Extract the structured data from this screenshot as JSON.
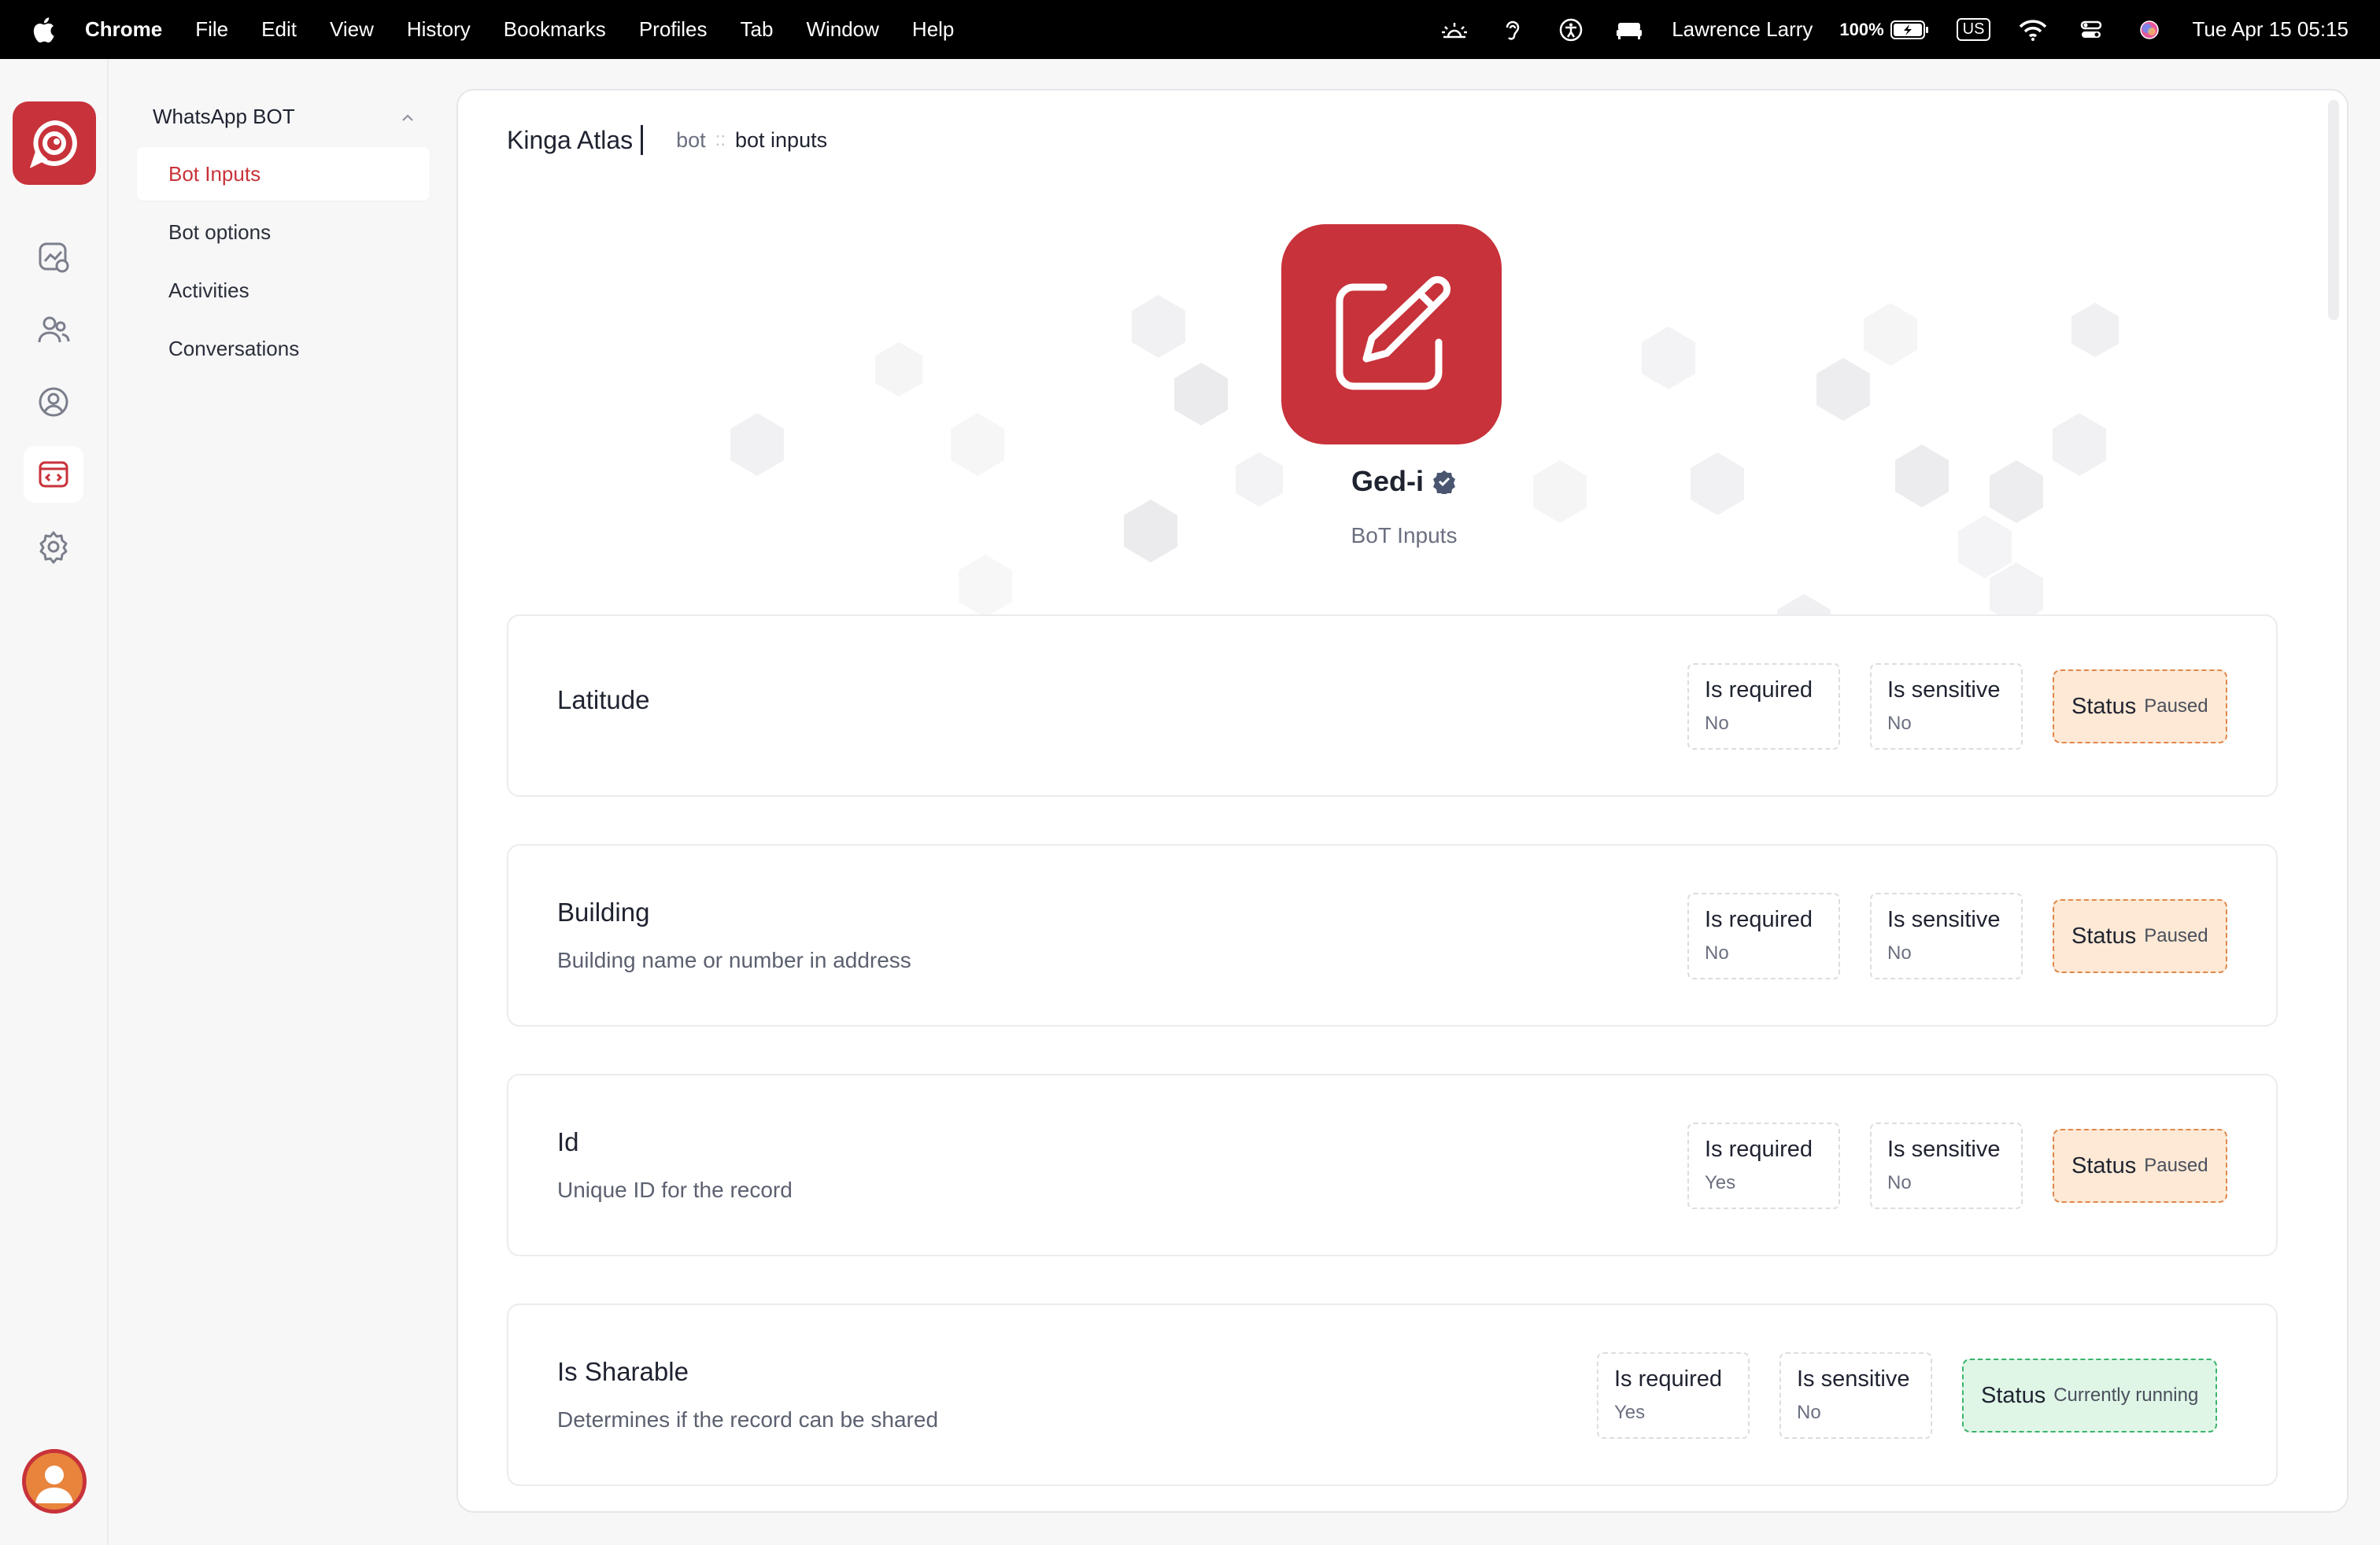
{
  "menubar": {
    "items": [
      "Chrome",
      "File",
      "Edit",
      "View",
      "History",
      "Bookmarks",
      "Profiles",
      "Tab",
      "Window",
      "Help"
    ],
    "user": "Lawrence Larry",
    "battery": "100%",
    "keyboard": "US",
    "datetime": "Tue Apr 15  05:15"
  },
  "subnav": {
    "group": "WhatsApp BOT",
    "items": [
      "Bot Inputs",
      "Bot options",
      "Activities",
      "Conversations"
    ]
  },
  "breadcrumb": {
    "workspace": "Kinga Atlas",
    "parent": "bot",
    "separator": "::",
    "current": "bot inputs"
  },
  "hero": {
    "title": "Ged-i",
    "subtitle": "BoT Inputs"
  },
  "labels": {
    "required": "Is required",
    "sensitive": "Is sensitive",
    "status": "Status"
  },
  "inputs": [
    {
      "name": "Latitude",
      "description": "",
      "required": "No",
      "sensitive": "No",
      "status": "Paused"
    },
    {
      "name": "Building",
      "description": "Building name or number in address",
      "required": "No",
      "sensitive": "No",
      "status": "Paused"
    },
    {
      "name": "Id",
      "description": "Unique ID for the record",
      "required": "Yes",
      "sensitive": "No",
      "status": "Paused"
    },
    {
      "name": "Is Sharable",
      "description": "Determines if the record can be shared",
      "required": "Yes",
      "sensitive": "No",
      "status": "Currently running"
    }
  ],
  "colors": {
    "brand": "#c8323a",
    "paused_bg": "#fde9d5",
    "running_bg": "#dff6e7"
  }
}
